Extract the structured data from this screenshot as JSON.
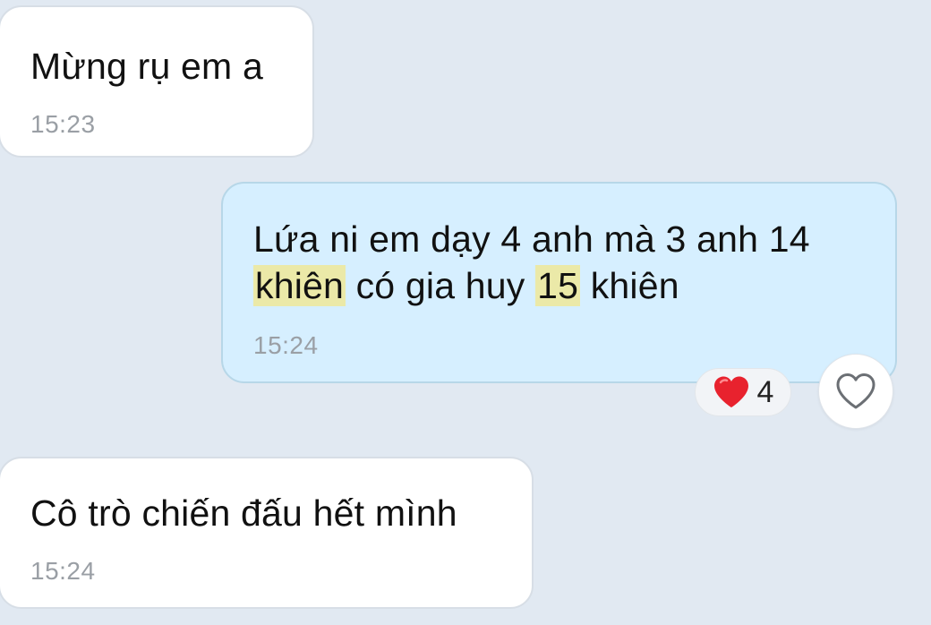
{
  "messages": [
    {
      "direction": "incoming",
      "text": "Mừng rụ em a",
      "time": "15:23"
    },
    {
      "direction": "outgoing",
      "line1": "Lứa ni em dạy 4 anh mà 3 anh 14",
      "line2_hl1": "khiên",
      "line2_mid": " có gia huy ",
      "line2_hl2": "15",
      "line2_end": " khiên",
      "time": "15:24",
      "reaction": {
        "icon": "heart-icon",
        "count": "4"
      },
      "like_icon": "heart-outline-icon"
    },
    {
      "direction": "incoming",
      "text": "Cô trò chiến đấu hết mình",
      "time": "15:24"
    }
  ],
  "colors": {
    "background": "#e1e9f2",
    "incoming_bubble": "#ffffff",
    "outgoing_bubble": "#d6efff",
    "highlight": "#ebe9a8",
    "timestamp": "#9a9fa5",
    "reaction_heart": "#e8222e"
  }
}
